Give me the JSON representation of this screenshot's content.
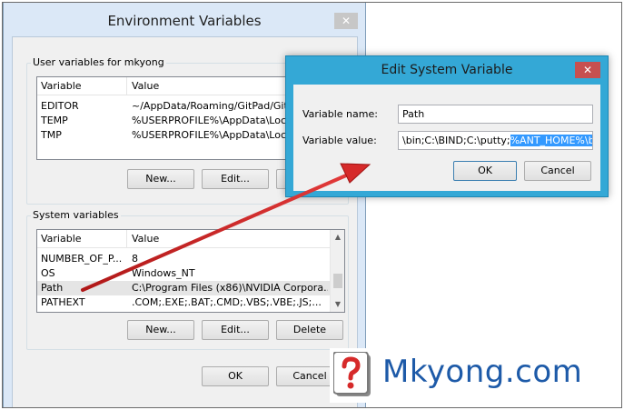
{
  "env_window": {
    "title": "Environment Variables",
    "close_glyph": "✕",
    "user_group_label": "User variables for mkyong",
    "user_columns": [
      "Variable",
      "Value"
    ],
    "user_rows": [
      {
        "variable": "EDITOR",
        "value": "~/AppData/Roaming/GitPad/GitPad"
      },
      {
        "variable": "TEMP",
        "value": "%USERPROFILE%\\AppData\\Local\\"
      },
      {
        "variable": "TMP",
        "value": "%USERPROFILE%\\AppData\\Local\\"
      }
    ],
    "user_buttons": {
      "new": "New...",
      "edit": "Edit..."
    },
    "system_group_label": "System variables",
    "system_columns": [
      "Variable",
      "Value"
    ],
    "system_rows": [
      {
        "variable": "NUMBER_OF_P...",
        "value": "8"
      },
      {
        "variable": "OS",
        "value": "Windows_NT"
      },
      {
        "variable": "Path",
        "value": "C:\\Program Files (x86)\\NVIDIA Corpora..."
      },
      {
        "variable": "PATHEXT",
        "value": ".COM;.EXE;.BAT;.CMD;.VBS;.VBE;.JS;..."
      }
    ],
    "system_buttons": {
      "new": "New...",
      "edit": "Edit...",
      "delete": "Delete"
    },
    "ok_label": "OK",
    "cancel_label": "Cancel"
  },
  "edit_dialog": {
    "title": "Edit System Variable",
    "close_glyph": "✕",
    "name_label": "Variable name:",
    "name_value": "Path",
    "value_label": "Variable value:",
    "value_plain": "\\bin;C:\\BIND;C:\\putty;",
    "value_selected": "%ANT_HOME%\\bin",
    "ok_label": "OK",
    "cancel_label": "Cancel"
  },
  "watermark": {
    "text": "Mkyong.com",
    "icon": "question-mark-logo-icon"
  },
  "colors": {
    "dialog_frame": "#34a8d6",
    "selection": "#3399ff",
    "arrow": "#d62a2a",
    "brand": "#1d5aa8"
  }
}
